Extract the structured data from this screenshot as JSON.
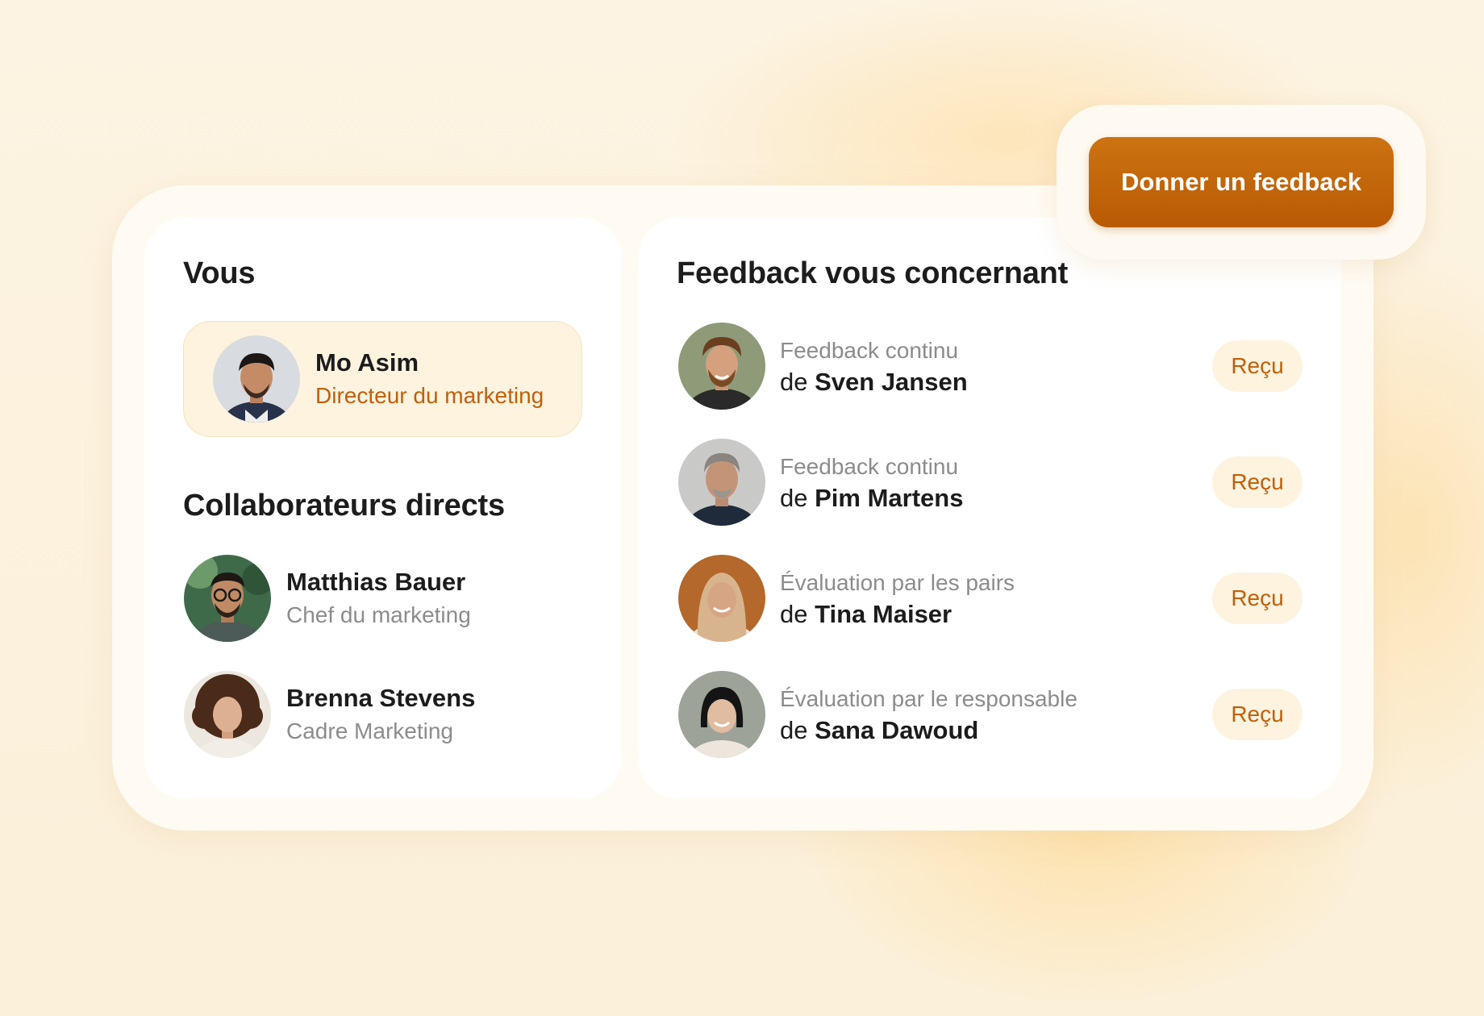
{
  "you": {
    "heading": "Vous",
    "name": "Mo Asim",
    "role": "Directeur du marketing"
  },
  "reports": {
    "heading": "Collaborateurs directs",
    "items": [
      {
        "name": "Matthias Bauer",
        "role": "Chef du marketing"
      },
      {
        "name": "Brenna Stevens",
        "role": "Cadre Marketing"
      }
    ]
  },
  "feedback": {
    "heading": "Feedback vous concernant",
    "from_prefix": "de",
    "items": [
      {
        "type": "Feedback continu",
        "from": "Sven Jansen",
        "status": "Reçu"
      },
      {
        "type": "Feedback continu",
        "from": "Pim Martens",
        "status": "Reçu"
      },
      {
        "type": "Évaluation par les pairs",
        "from": "Tina Maiser",
        "status": "Reçu"
      },
      {
        "type": "Évaluation par le responsable",
        "from": "Sana Dawoud",
        "status": "Reçu"
      }
    ]
  },
  "cta": {
    "label": "Donner un feedback"
  },
  "colors": {
    "accent": "#c0600a",
    "button": "#c46a0a",
    "badge_bg": "#fdf3df",
    "muted_text": "#8c8c8c"
  }
}
